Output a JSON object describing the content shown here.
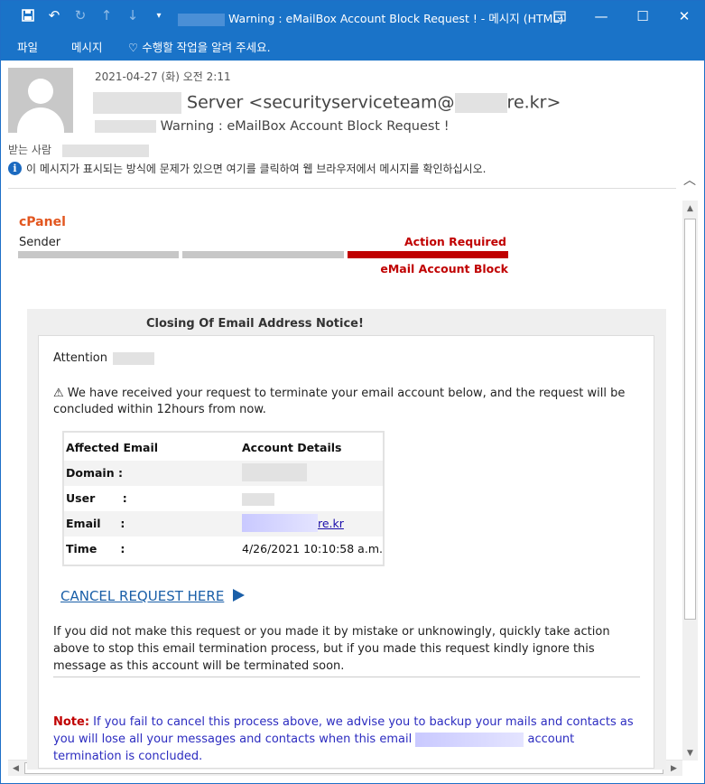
{
  "window": {
    "title": "Warning : eMailBox Account Block Request ! - 메시지 (HTML)",
    "minimize_icon": "minimize-icon",
    "maximize_icon": "maximize-icon",
    "close_icon": "close-icon"
  },
  "ribbon": {
    "tabs": [
      "파일",
      "메시지"
    ],
    "tell_me": "수행할 작업을 알려 주세요."
  },
  "header": {
    "date": "2021-04-27 (화) 오전 2:11",
    "from_name": "Server",
    "from_email_prefix": "<securityserviceteam@",
    "from_email_suffix": "re.kr>",
    "subject": "Warning : eMailBox Account Block Request !",
    "to_label": "받는 사람",
    "info_text": "이 메시지가 표시되는 방식에 문제가 있으면 여기를 클릭하여 웹 브라우저에서 메시지를 확인하십시오."
  },
  "email": {
    "brand": "cPanel",
    "sender": "Sender",
    "action_required": "Action Required",
    "account_block": "eMail Account Block",
    "notice_title": "Closing Of Email Address Notice!",
    "attention": "Attention",
    "warning_text": "⚠ We have received your request to terminate your email account below, and the request will be concluded within 12hours from now.",
    "table": {
      "header": [
        "Affected Email",
        "Account Details"
      ],
      "rows": [
        {
          "label": "Domain :",
          "value": ""
        },
        {
          "label": "User       :",
          "value": ""
        },
        {
          "label": "Email     :",
          "value": "re.kr"
        },
        {
          "label": "Time      :",
          "value": "4/26/2021 10:10:58 a.m."
        }
      ]
    },
    "cancel_link": "CANCEL REQUEST HERE",
    "paragraph": "If you did not make this request or you made it by mistake or unknowingly, quickly take action above to stop this email termination process, but if you made this request kindly ignore this message as this account will be terminated soon.",
    "note_label": "Note:",
    "note_text_1": " If you fail to cancel this process above, we advise you to backup your mails and contacts as you will lose all your messages and contacts when this email",
    "note_text_2": " account termination is concluded."
  },
  "colors": {
    "titlebar": "#1a73c8",
    "brand": "#e2561f",
    "alert_red": "#c00000",
    "link_blue": "#1a5fa8"
  }
}
